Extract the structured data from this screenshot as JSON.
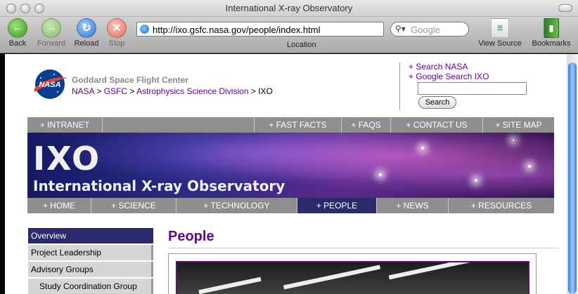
{
  "window": {
    "title": "International X-ray Observatory"
  },
  "toolbar": {
    "back": "Back",
    "forward": "Forward",
    "reload": "Reload",
    "stop": "Stop",
    "url": "http://ixo.gsfc.nasa.gov/people/index.html",
    "location_label": "Location",
    "search_placeholder": "Google",
    "view_source": "View Source",
    "bookmarks": "Bookmarks"
  },
  "header": {
    "gsfc": "Goddard Space Flight Center",
    "breadcrumb": [
      {
        "label": "NASA",
        "link": true
      },
      {
        "label": "GSFC",
        "link": true
      },
      {
        "label": "Astrophysics Science Division",
        "link": true
      },
      {
        "label": "IXO",
        "link": false
      }
    ],
    "separator": ">",
    "search_nasa": "+ Search NASA",
    "google_search": "+ Google Search IXO",
    "search_button": "Search"
  },
  "utility_nav": [
    "+ INTRANET",
    "+ FAST FACTS",
    "+ FAQS",
    "+ CONTACT US",
    "+ SITE MAP"
  ],
  "banner": {
    "acronym": "IXO",
    "name": "International X-ray Observatory"
  },
  "main_nav": [
    "+ HOME",
    "+ SCIENCE",
    "+ TECHNOLOGY",
    "+ PEOPLE",
    "+ NEWS",
    "+ RESOURCES"
  ],
  "main_nav_active": "+ PEOPLE",
  "sidebar": [
    "Overview",
    "Project Leadership",
    "Advisory Groups",
    "Study Coordination Group"
  ],
  "content": {
    "title": "People"
  },
  "colors": {
    "link": "#660099",
    "nav_active": "#2b2b6b",
    "nav_bar": "#8e8e8e"
  }
}
